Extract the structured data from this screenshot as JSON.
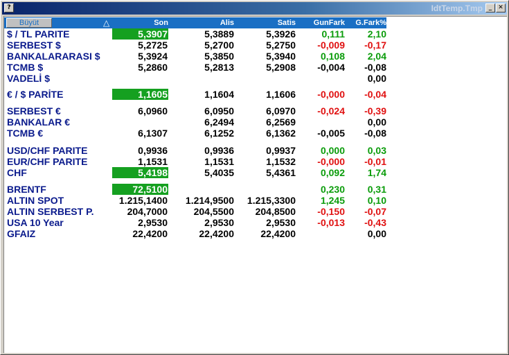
{
  "window": {
    "title": "IdtTemp.Tmp",
    "help_label": "?",
    "minimize_label": "_",
    "close_label": "✕"
  },
  "header": {
    "buyut_label": "Büyüt",
    "sort_icon": "△",
    "columns": [
      "Son",
      "Alis",
      "Satis",
      "GunFark",
      "G.Fark%"
    ]
  },
  "rows": [
    {
      "name": "$ / TL PARITE",
      "son": "5,3907",
      "alis": "5,3889",
      "satis": "5,3926",
      "gunfark": "0,111",
      "gfark": "2,10",
      "gunfark_sign": "pos",
      "gfark_sign": "pos",
      "son_highlight": true
    },
    {
      "name": "SERBEST $",
      "son": "5,2725",
      "alis": "5,2700",
      "satis": "5,2750",
      "gunfark": "-0,009",
      "gfark": "-0,17",
      "gunfark_sign": "neg",
      "gfark_sign": "neg",
      "son_highlight": false
    },
    {
      "name": "BANKALARARASI $",
      "son": "5,3924",
      "alis": "5,3850",
      "satis": "5,3940",
      "gunfark": "0,108",
      "gfark": "2,04",
      "gunfark_sign": "pos",
      "gfark_sign": "pos",
      "son_highlight": false
    },
    {
      "name": "TCMB $",
      "son": "5,2860",
      "alis": "5,2813",
      "satis": "5,2908",
      "gunfark": "-0,004",
      "gfark": "-0,08",
      "gunfark_sign": "zero",
      "gfark_sign": "zero",
      "son_highlight": false
    },
    {
      "name": "VADELİ $",
      "son": "",
      "alis": "",
      "satis": "",
      "gunfark": "",
      "gfark": "0,00",
      "gunfark_sign": "zero",
      "gfark_sign": "zero",
      "son_highlight": false
    },
    {
      "name": "€ / $ PARİTE",
      "son": "1,1605",
      "alis": "1,1604",
      "satis": "1,1606",
      "gunfark": "-0,000",
      "gfark": "-0,04",
      "gunfark_sign": "neg",
      "gfark_sign": "neg",
      "son_highlight": true
    },
    {
      "name": "SERBEST €",
      "son": "6,0960",
      "alis": "6,0950",
      "satis": "6,0970",
      "gunfark": "-0,024",
      "gfark": "-0,39",
      "gunfark_sign": "neg",
      "gfark_sign": "neg",
      "son_highlight": false
    },
    {
      "name": "BANKALAR €",
      "son": "",
      "alis": "6,2494",
      "satis": "6,2569",
      "gunfark": "",
      "gfark": "0,00",
      "gunfark_sign": "zero",
      "gfark_sign": "zero",
      "son_highlight": false
    },
    {
      "name": "TCMB €",
      "son": "6,1307",
      "alis": "6,1252",
      "satis": "6,1362",
      "gunfark": "-0,005",
      "gfark": "-0,08",
      "gunfark_sign": "zero",
      "gfark_sign": "zero",
      "son_highlight": false
    },
    {
      "name": "USD/CHF PARITE",
      "son": "0,9936",
      "alis": "0,9936",
      "satis": "0,9937",
      "gunfark": "0,000",
      "gfark": "0,03",
      "gunfark_sign": "pos",
      "gfark_sign": "pos",
      "son_highlight": false
    },
    {
      "name": "EUR/CHF PARITE",
      "son": "1,1531",
      "alis": "1,1531",
      "satis": "1,1532",
      "gunfark": "-0,000",
      "gfark": "-0,01",
      "gunfark_sign": "neg",
      "gfark_sign": "neg",
      "son_highlight": false
    },
    {
      "name": "CHF",
      "son": "5,4198",
      "alis": "5,4035",
      "satis": "5,4361",
      "gunfark": "0,092",
      "gfark": "1,74",
      "gunfark_sign": "pos",
      "gfark_sign": "pos",
      "son_highlight": true
    },
    {
      "name": "BRENTF",
      "son": "72,5100",
      "alis": "",
      "satis": "",
      "gunfark": "0,230",
      "gfark": "0,31",
      "gunfark_sign": "pos",
      "gfark_sign": "pos",
      "son_highlight": true
    },
    {
      "name": "ALTIN SPOT",
      "son": "1.215,1400",
      "alis": "1.214,9500",
      "satis": "1.215,3300",
      "gunfark": "1,245",
      "gfark": "0,10",
      "gunfark_sign": "pos",
      "gfark_sign": "pos",
      "son_highlight": false
    },
    {
      "name": "ALTIN SERBEST P.",
      "son": "204,7000",
      "alis": "204,5500",
      "satis": "204,8500",
      "gunfark": "-0,150",
      "gfark": "-0,07",
      "gunfark_sign": "neg",
      "gfark_sign": "neg",
      "son_highlight": false
    },
    {
      "name": "USA 10 Year",
      "son": "2,9530",
      "alis": "2,9530",
      "satis": "2,9530",
      "gunfark": "-0,013",
      "gfark": "-0,43",
      "gunfark_sign": "neg",
      "gfark_sign": "neg",
      "son_highlight": false
    },
    {
      "name": "GFAIZ",
      "son": "22,4200",
      "alis": "22,4200",
      "satis": "22,4200",
      "gunfark": "",
      "gfark": "0,00",
      "gunfark_sign": "zero",
      "gfark_sign": "zero",
      "son_highlight": false
    }
  ],
  "colors": {
    "positive": "#0a9c0a",
    "negative": "#e01010",
    "highlight": "#15a020",
    "header": "#1a6fc4",
    "name": "#0a1a8c"
  }
}
